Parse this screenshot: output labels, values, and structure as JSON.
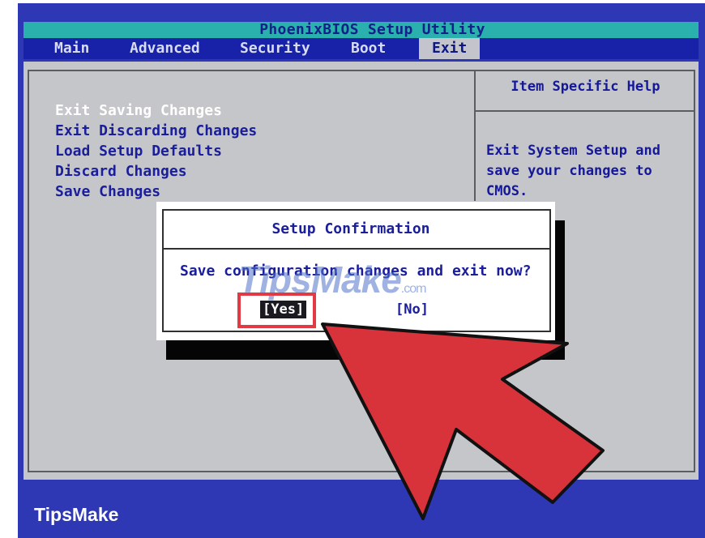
{
  "app": {
    "title": "PhoenixBIOS Setup Utility"
  },
  "menu": {
    "tabs": [
      {
        "label": "Main"
      },
      {
        "label": "Advanced"
      },
      {
        "label": "Security"
      },
      {
        "label": "Boot"
      },
      {
        "label": "Exit",
        "active": true
      }
    ]
  },
  "exit_menu": {
    "options": [
      {
        "label": "Exit Saving Changes",
        "selected": true
      },
      {
        "label": "Exit Discarding Changes"
      },
      {
        "label": "Load Setup Defaults"
      },
      {
        "label": "Discard Changes"
      },
      {
        "label": "Save Changes"
      }
    ]
  },
  "help": {
    "title": "Item Specific Help",
    "lines": [
      "Exit System Setup and",
      "save your changes to",
      "CMOS."
    ]
  },
  "dialog": {
    "title": "Setup Confirmation",
    "message": "Save configuration changes and exit now?",
    "yes_label": "[Yes]",
    "no_label": "[No]"
  },
  "watermark": {
    "text": "TipsMake",
    "suffix": ".com"
  },
  "brand": {
    "label": "TipsMake"
  },
  "colors": {
    "frame": "#2f38b4",
    "titlebar": "#2ab1ad",
    "menubar": "#1722a8",
    "panel": "#c5c6c9",
    "bios_text": "#1a1e9a",
    "highlight": "#e13a44",
    "arrow": "#d8323b"
  }
}
